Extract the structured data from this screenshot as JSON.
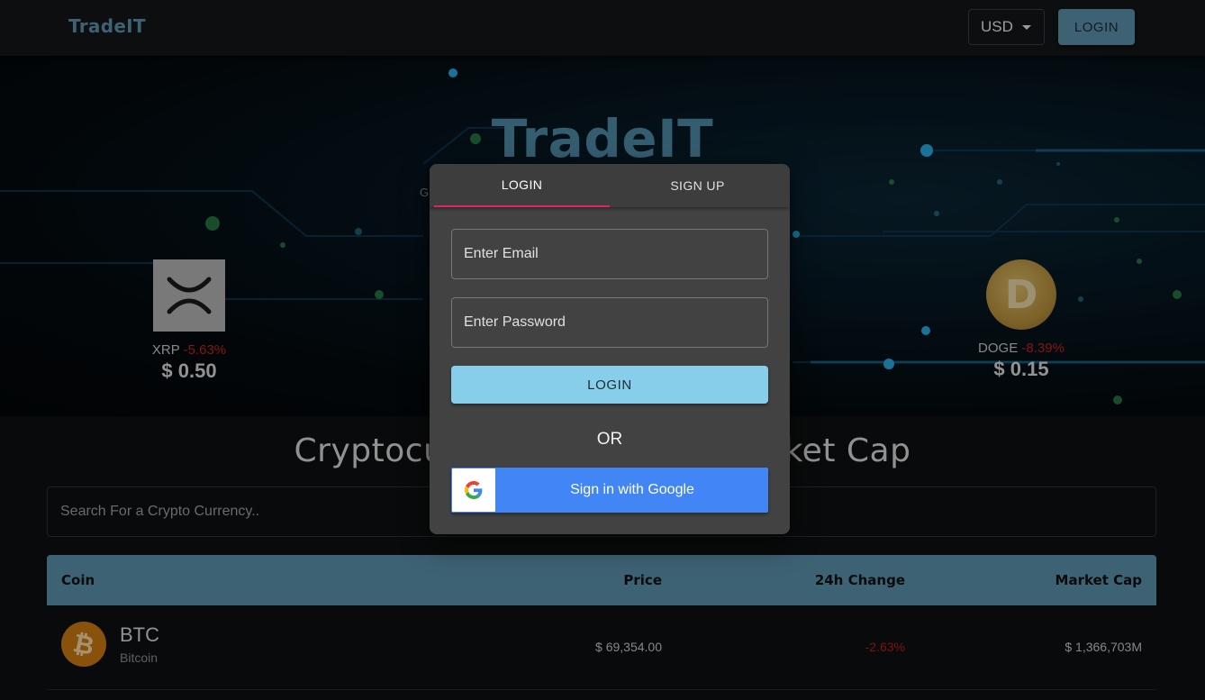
{
  "header": {
    "logo": "TradeIT",
    "currency": "USD",
    "login_label": "LOGIN"
  },
  "hero": {
    "title": "TradeIT",
    "subtitle_fragment": "G",
    "coins": [
      {
        "symbol": "XRP",
        "change": "-5.63%",
        "price": "$ 0.50"
      },
      {
        "symbol": "DOGE",
        "change": "-8.39%",
        "price": "$ 0.15"
      }
    ]
  },
  "main": {
    "section_title": "Cryptocurrency Prices by Market Cap",
    "search_placeholder": "Search For a Crypto Currency..",
    "table": {
      "columns": [
        "Coin",
        "Price",
        "24h Change",
        "Market Cap"
      ],
      "rows": [
        {
          "symbol": "BTC",
          "name": "Bitcoin",
          "price": "$ 69,354.00",
          "change": "-2.63%",
          "market_cap": "$ 1,366,703M"
        }
      ]
    }
  },
  "modal": {
    "tabs": [
      "LOGIN",
      "SIGN UP"
    ],
    "email_placeholder": "Enter Email",
    "password_placeholder": "Enter Password",
    "submit_label": "LOGIN",
    "divider": "OR",
    "google_label": "Sign in with Google"
  },
  "colors": {
    "accent": "#5b91ac",
    "tab_indicator": "#e0245e",
    "submit": "#87ceeb",
    "google": "#4285f4",
    "negative": "#c41f1f"
  }
}
